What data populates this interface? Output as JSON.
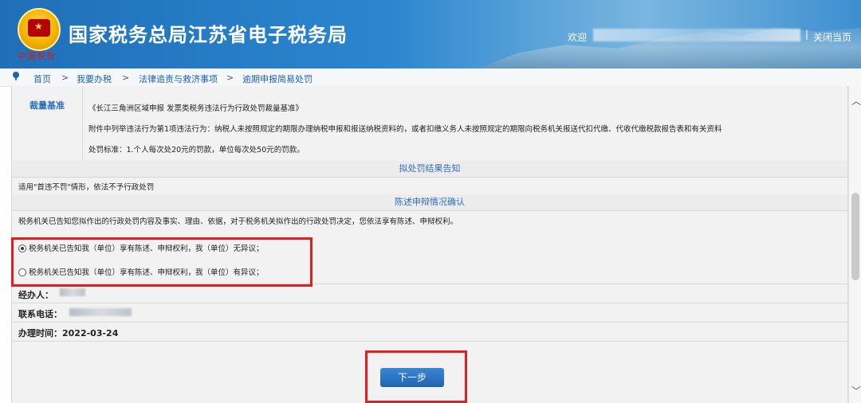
{
  "header": {
    "title": "国家税务总局江苏省电子税务局",
    "brand_mark": "中国税务",
    "welcome": "欢迎",
    "separator": "|",
    "close_label": "关闭当页"
  },
  "breadcrumb": {
    "items": [
      "首页",
      "我要办税",
      "法律追责与救济事项",
      "逾期申报简易处罚"
    ],
    "arrow": ">"
  },
  "discretion": {
    "label": "裁量基准",
    "cut_text": "…",
    "lines": [
      "《长江三角洲区域申报 发票类税务违法行为行政处罚裁量基准》",
      "附件中列举违法行为第1项违法行为：纳税人未按照规定的期限办理纳税申报和报送纳税资料的，或者扣缴义务人未按照规定的期限向税务机关报送代扣代缴、代收代缴税款报告表和有关资料",
      "处罚标准：1.个人每次处20元的罚款，单位每次处50元的罚款。"
    ]
  },
  "penalty_result": {
    "heading": "拟处罚结果告知",
    "text": "适用\"首违不罚\"情形，依法不予行政处罚"
  },
  "statement": {
    "heading": "陈述申辩情况确认",
    "notice": "税务机关已告知您拟作出的行政处罚内容及事实、理由、依据，对于税务机关拟作出的行政处罚决定，您依法享有陈述、申辩权利。",
    "options": [
      {
        "label": "税务机关已告知我（单位）享有陈述、申辩权利，我（单位）无异议；",
        "checked": true
      },
      {
        "label": "税务机关已告知我（单位）享有陈述、申辩权利，我（单位）有异议；",
        "checked": false
      }
    ]
  },
  "info": {
    "handler_label": "经办人：",
    "phone_label": "联系电话：",
    "date_label": "办理时间：",
    "date_value": "2022-03-24"
  },
  "actions": {
    "next_label": "下一步"
  },
  "icons": {
    "pin": "location-pin-icon",
    "scroll_up": "chevron-up-icon",
    "scroll_down": "chevron-down-icon"
  },
  "colors": {
    "header_blue": "#2b86cf",
    "link_blue": "#1b62b8",
    "highlight_red": "#e02020",
    "button_blue": "#1e65b3"
  }
}
